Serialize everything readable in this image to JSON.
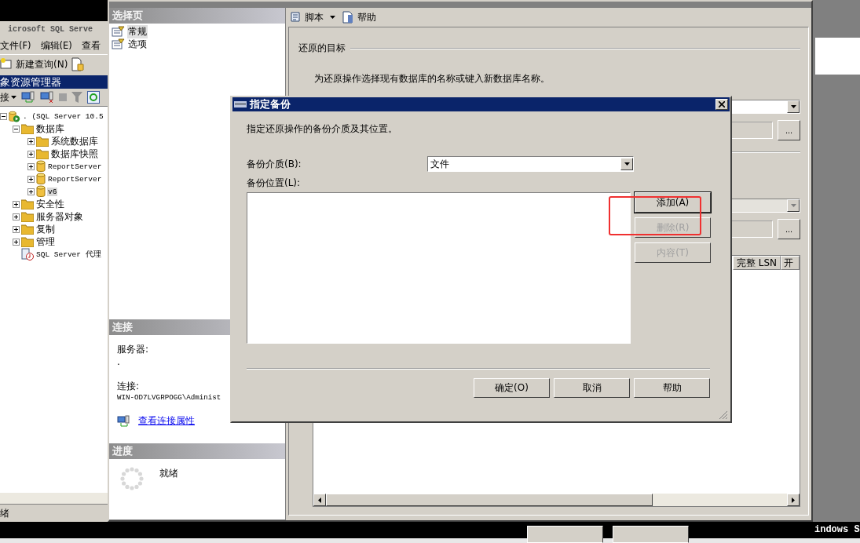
{
  "desktop": {
    "taskbar_text": "indows S"
  },
  "ssms": {
    "title": "icrosoft SQL Serve",
    "menu": [
      "文件(F)",
      "编辑(E)",
      "查看"
    ],
    "new_query": "新建查询(N)",
    "explorer_title": "象资源管理器",
    "connect": "接",
    "tree": [
      {
        "label": ". (SQL Server 10.5",
        "kind": "server",
        "expanded": true,
        "selected": false,
        "children": [
          {
            "label": "数据库",
            "kind": "folder",
            "expanded": true,
            "selected": false,
            "children": [
              {
                "label": "系统数据库",
                "kind": "folder",
                "expanded": false,
                "selected": false
              },
              {
                "label": "数据库快照",
                "kind": "folder",
                "expanded": false,
                "selected": false
              },
              {
                "label": "ReportServer",
                "kind": "database",
                "expanded": false,
                "selected": false
              },
              {
                "label": "ReportServer",
                "kind": "database",
                "expanded": false,
                "selected": false
              },
              {
                "label": "v6",
                "kind": "database",
                "expanded": false,
                "selected": true
              }
            ]
          },
          {
            "label": "安全性",
            "kind": "folder",
            "expanded": false,
            "selected": false
          },
          {
            "label": "服务器对象",
            "kind": "folder",
            "expanded": false,
            "selected": false
          },
          {
            "label": "复制",
            "kind": "folder",
            "expanded": false,
            "selected": false
          },
          {
            "label": "管理",
            "kind": "folder",
            "expanded": false,
            "selected": false
          },
          {
            "label": "SQL Server 代理",
            "kind": "agent",
            "selected": false
          }
        ]
      }
    ],
    "status": "绪"
  },
  "restore": {
    "toolbar": [
      {
        "label": "脚本",
        "kind": "script"
      },
      {
        "label": "帮助",
        "kind": "help"
      }
    ],
    "pages_header": "选择页",
    "pages": [
      {
        "label": "常规",
        "selected": true
      },
      {
        "label": "选项",
        "selected": false
      }
    ],
    "connection": {
      "header": "连接",
      "server_label": "服务器:",
      "server": ".",
      "connection_label": "连接:",
      "connection": "WIN-OD7LVGRPOGG\\Administ",
      "link": "查看连接属性"
    },
    "progress": {
      "header": "进度",
      "status": "就绪"
    },
    "target_title": "还原的目标",
    "target_hint": "为还原操作选择现有数据库的名称或键入新数据库名称。",
    "fields": [
      {
        "kind": "dropdown",
        "disabled": false
      },
      {
        "kind": "browse",
        "disabled": true,
        "button": "..."
      },
      {
        "kind": "dropdown",
        "disabled": true
      },
      {
        "kind": "browse",
        "disabled": true,
        "button": "..."
      }
    ],
    "grid_columns": [
      "完整 LSN",
      "开"
    ]
  },
  "dialog": {
    "title": "指定备份",
    "description": "指定还原操作的备份介质及其位置。",
    "media_label": "备份介质(B):",
    "media_value": "文件",
    "location_label": "备份位置(L):",
    "side_buttons": [
      {
        "label": "添加(A)",
        "disabled": false,
        "highlighted": true
      },
      {
        "label": "删除(R)",
        "disabled": true,
        "highlighted": false
      },
      {
        "label": "内容(T)",
        "disabled": true,
        "highlighted": false
      }
    ],
    "buttons": [
      "确定(O)",
      "取消",
      "帮助"
    ]
  }
}
